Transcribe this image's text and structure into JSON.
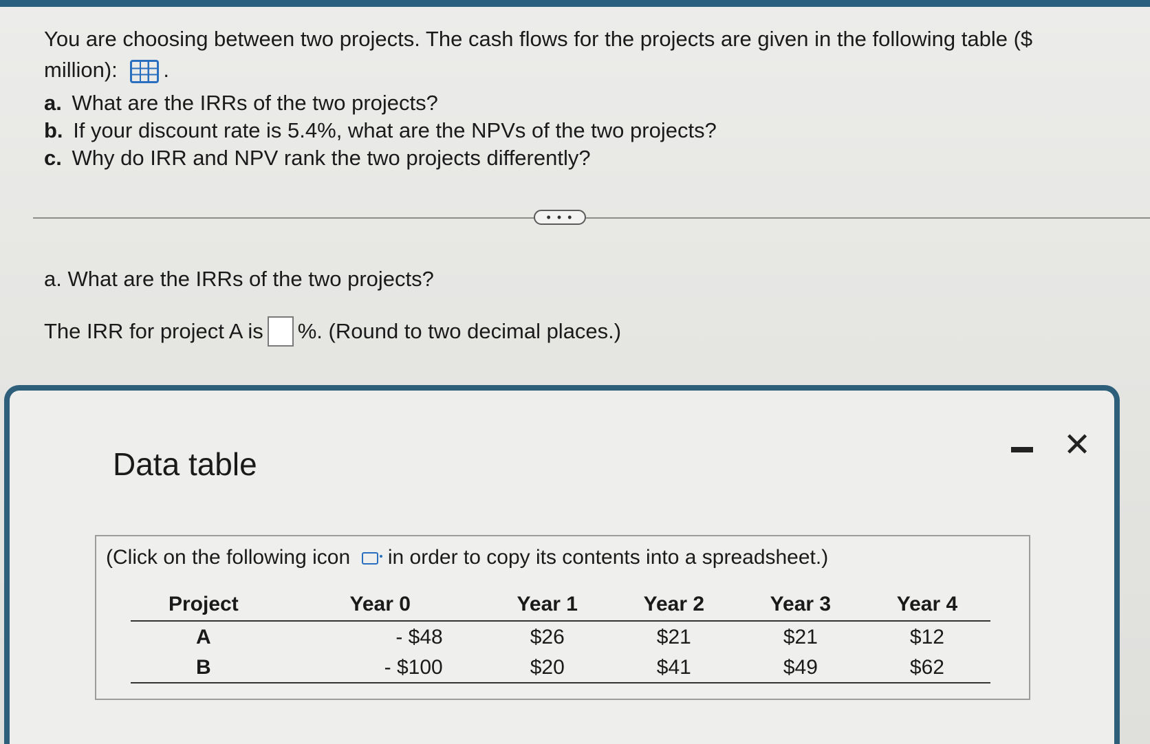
{
  "question": {
    "intro_line1": "You are choosing between two projects. The cash flows for the projects are given in the following table ($",
    "intro_line2": "million):",
    "intro_icon": "grid-table-icon",
    "parts": [
      {
        "letter": "a.",
        "text": "What are the IRRs of the two projects?"
      },
      {
        "letter": "b.",
        "text": "If your discount rate is 5.4%, what are the NPVs of the two projects?"
      },
      {
        "letter": "c.",
        "text": "Why do IRR and NPV rank the two projects differently?"
      }
    ]
  },
  "more_button": "• • •",
  "part_a": {
    "question": "a. What are the IRRs of the two projects?",
    "irr_prefix": "The IRR for project A is",
    "irr_value": "",
    "irr_suffix": "%. (Round to two decimal places.)"
  },
  "modal": {
    "title": "Data table",
    "close_label": "✕",
    "instruction_before": "(Click on the following icon",
    "instruction_after": "in order to copy its contents into a spreadsheet.)",
    "table": {
      "headers": [
        "Project",
        "Year 0",
        "Year 1",
        "Year 2",
        "Year 3",
        "Year 4"
      ],
      "rows": [
        [
          "A",
          "- $48",
          "$26",
          "$21",
          "$21",
          "$12"
        ],
        [
          "B",
          "- $100",
          "$20",
          "$41",
          "$49",
          "$62"
        ]
      ]
    }
  },
  "colors": {
    "accent_blue": "#2a6fbf",
    "modal_border": "#2e5f7a"
  }
}
